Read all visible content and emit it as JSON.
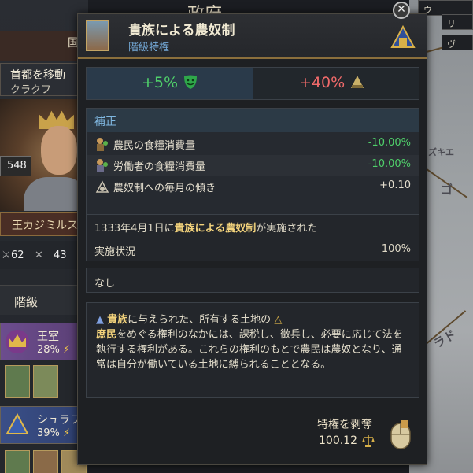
{
  "background": {
    "panel_title": "政府",
    "tab_label": "国",
    "move_capital": {
      "label": "首都を移動",
      "value": "クラクフ"
    },
    "ruler": {
      "level": "548",
      "name": "王カジミルス"
    },
    "stats": {
      "a": "62",
      "b": "43"
    },
    "classes_header": "階級",
    "classes": [
      {
        "name": "王室",
        "percent": "28%"
      },
      {
        "name": "シュラフ",
        "percent": "39%"
      }
    ],
    "map_labels": [
      "リ",
      "ヴ",
      "ウ",
      "ゴ",
      "ズキエ",
      "ラド"
    ]
  },
  "tooltip": {
    "title": "貴族による農奴制",
    "subtitle": "階級特権",
    "effects": {
      "left": "+5%",
      "right": "+40%"
    },
    "modifiers_header": "補正",
    "modifiers": [
      {
        "name": "農民の食糧消費量",
        "value": "-10.00%",
        "color": "#4fcf6a"
      },
      {
        "name": "労働者の食糧消費量",
        "value": "-10.00%",
        "color": "#4fcf6a"
      },
      {
        "name": "農奴制への毎月の傾き",
        "value": "+0.10",
        "color": "#e5dfcf"
      }
    ],
    "enacted": {
      "prefix": "1333年4月1日に",
      "name": "貴族による農奴制",
      "suffix": "が実施された"
    },
    "implementation": {
      "label": "実施状況",
      "value": "100%"
    },
    "none_text": "なし",
    "description": {
      "lead": "貴族",
      "part1": "に与えられた、所有する土地の",
      "commoner": "庶民",
      "part2": "をめぐる権利のなかには、課税し、徴兵し、必要に応じて法を執行する権利がある。これらの権利のもとで農民は農奴となり、通常は自分が働いている土地に縛られることとなる。"
    },
    "revoke": {
      "label": "特権を剥奪",
      "cost": "100.12"
    }
  },
  "colors": {
    "gold": "#f3d37c",
    "positive": "#4fcf6a",
    "negative": "#f06a6a",
    "header_blue": "#7fb7e0"
  }
}
